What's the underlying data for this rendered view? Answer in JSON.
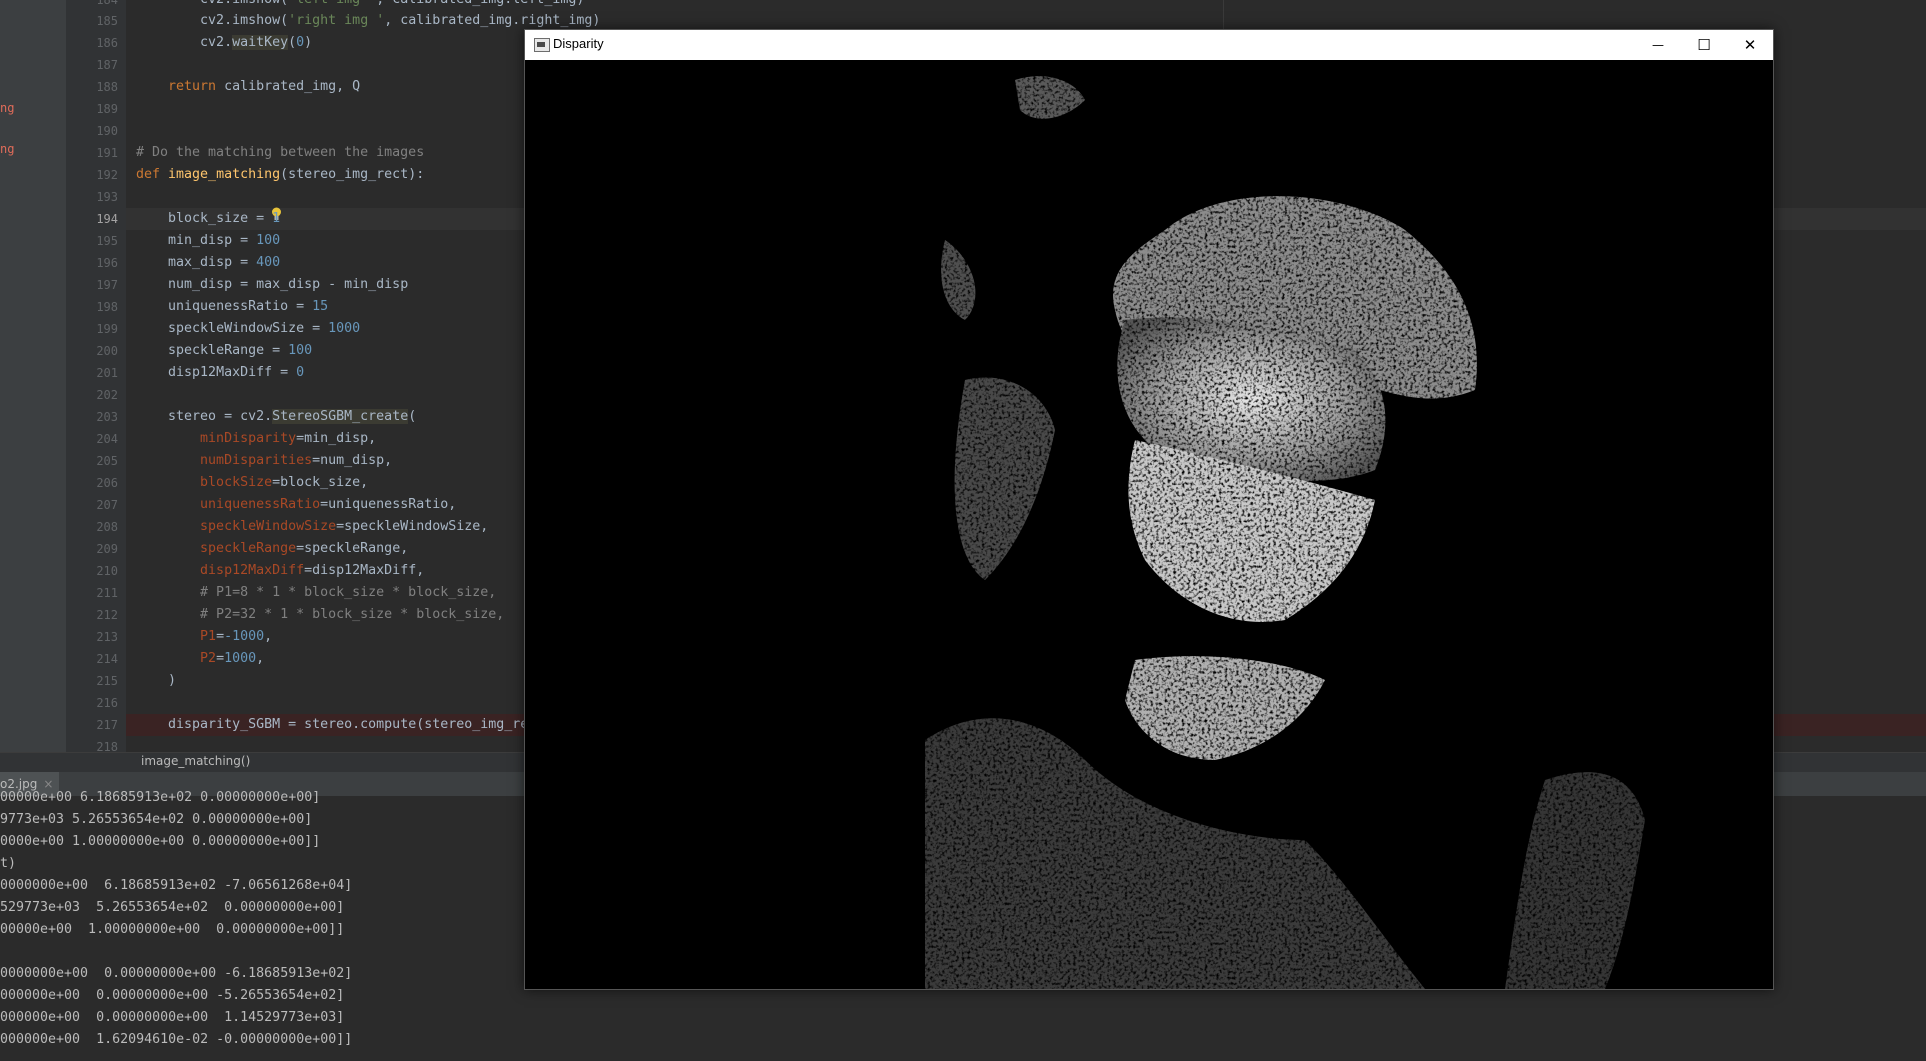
{
  "left_strip": {
    "labels": [
      "ng",
      "ng"
    ]
  },
  "editor": {
    "line_numbers": [
      "184",
      "185",
      "186",
      "187",
      "188",
      "189",
      "190",
      "191",
      "192",
      "193",
      "194",
      "195",
      "196",
      "197",
      "198",
      "199",
      "200",
      "201",
      "202",
      "203",
      "204",
      "205",
      "206",
      "207",
      "208",
      "209",
      "210",
      "211",
      "212",
      "213",
      "214",
      "215",
      "216",
      "217",
      "218"
    ],
    "current_line": "194",
    "breakpoint_line": "217"
  },
  "breadcrumb": {
    "label": "image_matching()"
  },
  "run_tab": {
    "label": "o2.jpg",
    "close": "×"
  },
  "console": {
    "lines": [
      "00000e+00 6.18685913e+02 0.00000000e+00]",
      "9773e+03 5.26553654e+02 0.00000000e+00]",
      "0000e+00 1.00000000e+00 0.00000000e+00]]",
      "t)",
      "0000000e+00  6.18685913e+02 -7.06561268e+04]",
      "529773e+03  5.26553654e+02  0.00000000e+00]",
      "00000e+00  1.00000000e+00  0.00000000e+00]]",
      "",
      "0000000e+00  0.00000000e+00 -6.18685913e+02]",
      "000000e+00  0.00000000e+00 -5.26553654e+02]",
      "000000e+00  0.00000000e+00  1.14529773e+03]",
      "000000e+00  1.62094610e-02 -0.00000000e+00]]"
    ]
  },
  "disparity_window": {
    "title": "Disparity",
    "minimize": "—",
    "maximize": "☐",
    "close": "✕"
  }
}
